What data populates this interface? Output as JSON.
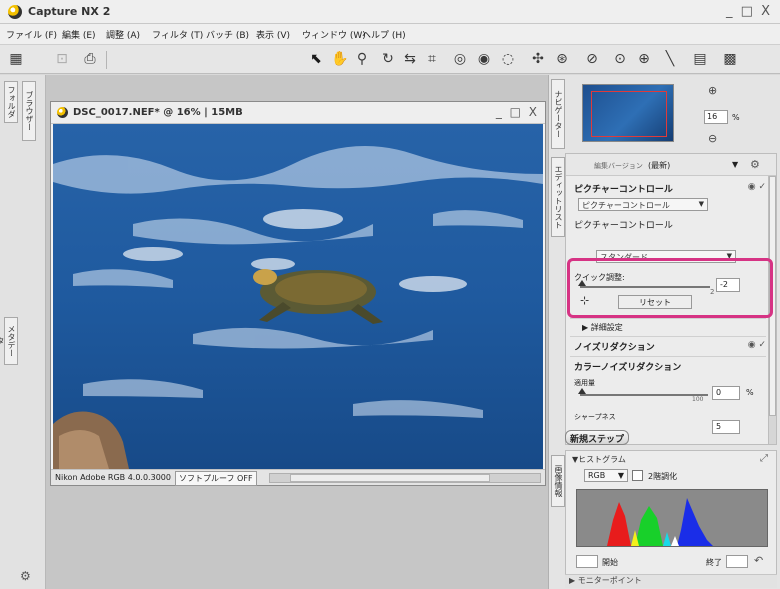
{
  "app": {
    "title": "Capture NX 2",
    "window_controls": "_ □ X"
  },
  "menu": [
    "ファイル (F)",
    "編集 (E)",
    "調整 (A)",
    "フィルタ (T)",
    "バッチ (B)",
    "表示 (V)",
    "ウィンドウ (W)",
    "ヘルプ (H)"
  ],
  "left_tabs": {
    "folder": "フォルダ",
    "browser": "ブラウザー",
    "metadata": "メタデータ"
  },
  "image_window": {
    "title": "DSC_0017.NEF* @ 16% | 15MB",
    "controls": "_ □ X",
    "color_profile": "Nikon Adobe RGB 4.0.0.3000",
    "softproof": "ソフトプルーフ OFF"
  },
  "right_tabs": {
    "navigator": "ナビゲーター",
    "edit_list": "エディットリスト",
    "image_info": "画像情報"
  },
  "navigator": {
    "zoom": "16",
    "unit": "%"
  },
  "edit_list": {
    "version_label": "編集バージョン",
    "version_value": "(最新)",
    "picture_control_title": "ピクチャーコントロール",
    "picture_control_dropdown": "ピクチャーコントロール",
    "picture_control_label": "ピクチャーコントロール",
    "preset_dropdown": "スタンダード",
    "quick_adjust_label": "クイック調整:",
    "quick_adjust_value": "-2",
    "quick_adjust_max": "2",
    "reset_button": "リセット",
    "advanced_label": "詳細設定",
    "noise_reduction": "ノイズリダクション",
    "color_noise_reduction": "カラーノイズリダクション",
    "apply_amount_label": "適用量",
    "apply_amount_max": "100",
    "apply_amount_value": "0",
    "apply_amount_unit": "%",
    "sharpness_label": "シャープネス",
    "sharpness_value": "5"
  },
  "new_step_button": "新規ステップ",
  "histogram": {
    "title": "ヒストグラム",
    "channel": "RGB",
    "checkbox_label": "2階調化",
    "start_label": "開始",
    "end_label": "終了"
  },
  "monitor_point": "モニターポイント",
  "colors": {
    "accent_highlight": "#d63384",
    "sea": "#1f5a9f"
  }
}
